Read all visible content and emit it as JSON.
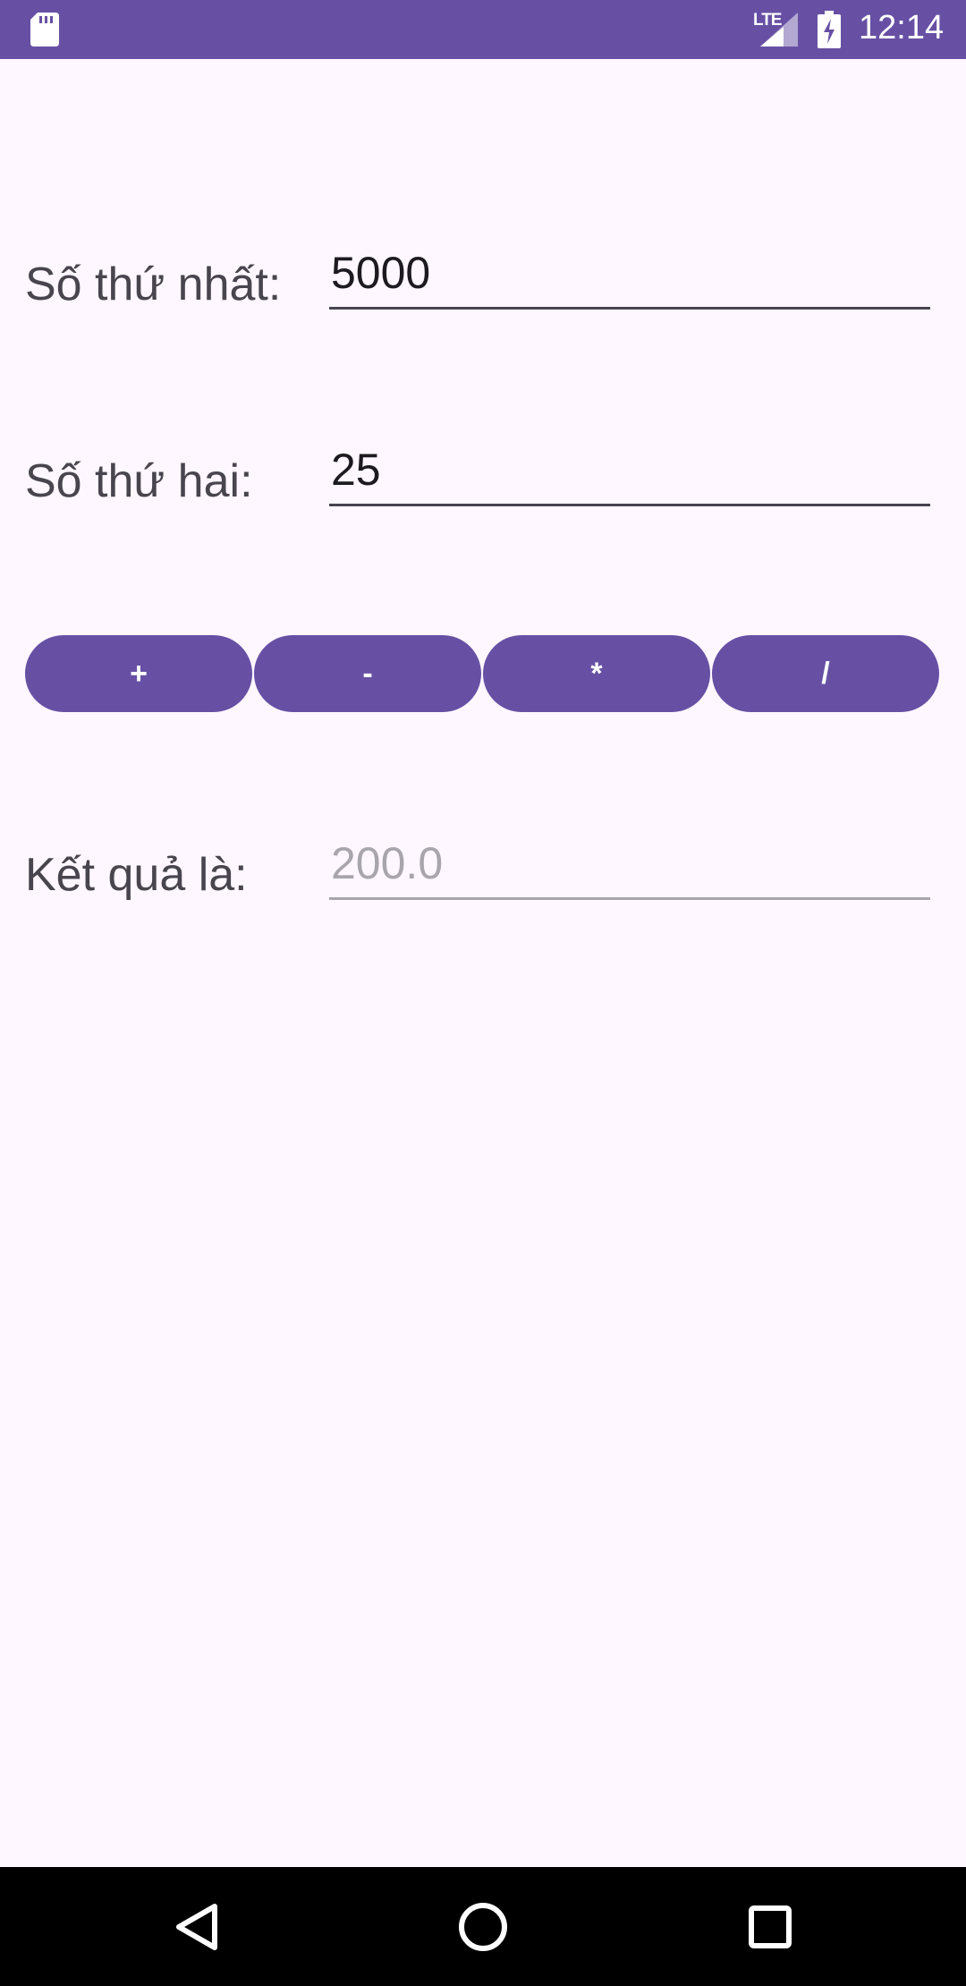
{
  "status_bar": {
    "time": "12:14",
    "network": "LTE",
    "icons": [
      "sd-card-icon",
      "signal-icon",
      "battery-charging-icon"
    ]
  },
  "form": {
    "first_number": {
      "label": "Số thứ nhất:",
      "value": "5000"
    },
    "second_number": {
      "label": "Số thứ hai:",
      "value": "25"
    },
    "result": {
      "label": "Kết quả là:",
      "placeholder": "200.0"
    }
  },
  "operations": [
    "+",
    "-",
    "*",
    "/"
  ],
  "nav_bar": {
    "icons": [
      "back-icon",
      "home-icon",
      "recents-icon"
    ]
  },
  "colors": {
    "primary": "#6750A4",
    "background": "#FEF7FF",
    "label_text": "#49454F",
    "hint_text": "#A9A5AD"
  }
}
